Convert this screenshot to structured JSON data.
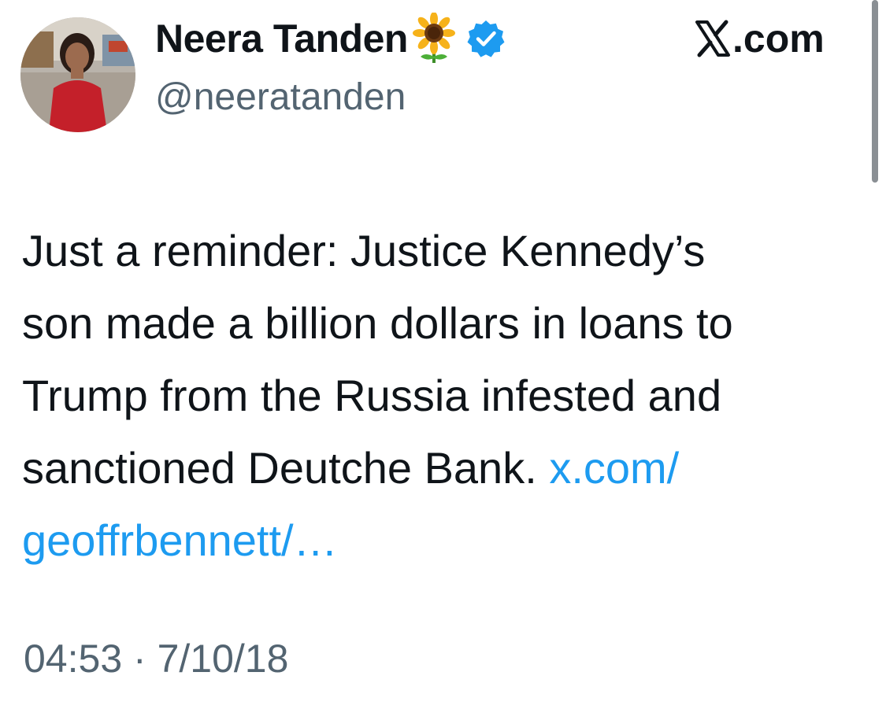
{
  "author": {
    "display_name": "Neera Tanden",
    "handle": "@neeratanden",
    "name_emoji_icon": "sunflower-icon",
    "verified_icon": "verified-badge-icon"
  },
  "brand": {
    "label": ".com",
    "icon": "x-logo-icon"
  },
  "tweet": {
    "lines": [
      "Just a reminder: Justice Kennedy’s",
      "son made a billion dollars in loans to",
      "Trump from the Russia infested and",
      "sanctioned Deutche Bank. "
    ],
    "link_part1": "x.com/",
    "link_part2": "geoffrbennett/…"
  },
  "meta": {
    "time": "04:53",
    "separator": " · ",
    "date": "7/10/18"
  },
  "colors": {
    "link": "#1d9bf0",
    "verified": "#1d9bf0",
    "secondary_text": "#536471",
    "primary_text": "#0f1419"
  }
}
